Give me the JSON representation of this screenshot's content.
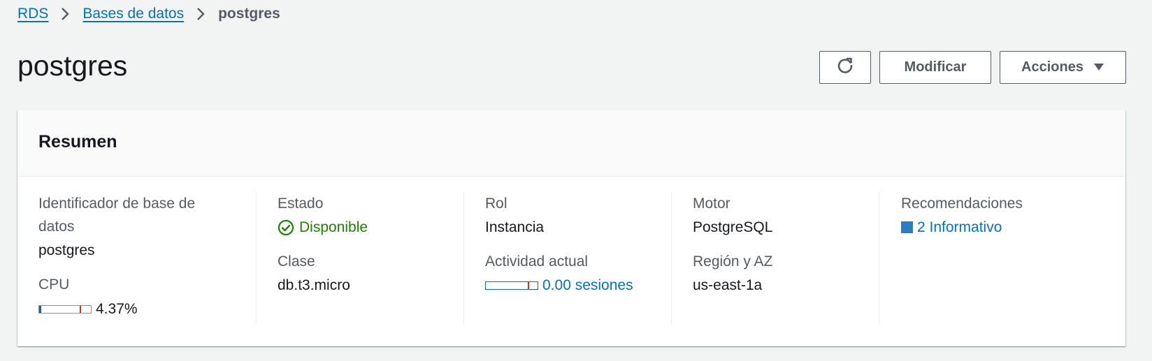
{
  "breadcrumb": {
    "items": [
      {
        "label": "RDS"
      },
      {
        "label": "Bases de datos"
      }
    ],
    "current": "postgres"
  },
  "page": {
    "title": "postgres"
  },
  "actions": {
    "refresh_icon": "refresh-icon",
    "modify_label": "Modificar",
    "actions_label": "Acciones"
  },
  "summary": {
    "title": "Resumen",
    "identifier": {
      "label": "Identificador de base de datos",
      "value": "postgres"
    },
    "cpu": {
      "label": "CPU",
      "value": "4.37%",
      "percent": 4.37
    },
    "status": {
      "label": "Estado",
      "value": "Disponible",
      "color": "#1d8102"
    },
    "class": {
      "label": "Clase",
      "value": "db.t3.micro"
    },
    "role": {
      "label": "Rol",
      "value": "Instancia"
    },
    "activity": {
      "label": "Actividad actual",
      "value": "0.00 sesiones",
      "sessions": 0.0
    },
    "engine": {
      "label": "Motor",
      "value": "PostgreSQL"
    },
    "region": {
      "label": "Región y AZ",
      "value": "us-east-1a"
    },
    "recommendations": {
      "label": "Recomendaciones",
      "value": "2 Informativo",
      "color": "#2a7dc4"
    }
  },
  "colors": {
    "link": "#0073bb",
    "success": "#1d8102",
    "threshold": "#d13212"
  }
}
